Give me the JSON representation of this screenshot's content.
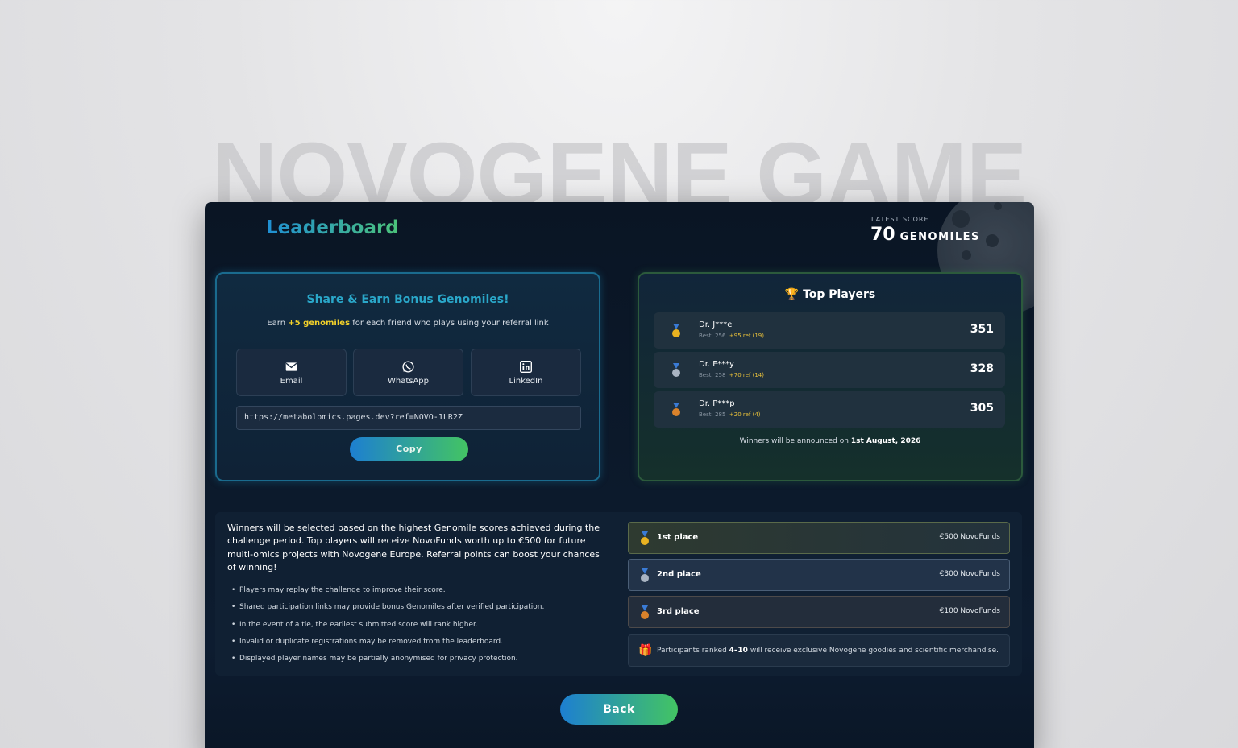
{
  "background_title": "NOVOGENE GAME",
  "header": {
    "title": "Leaderboard",
    "score_label": "LATEST SCORE",
    "score_value": "70",
    "score_unit": "GENOMILES"
  },
  "share": {
    "title": "Share & Earn Bonus Genomiles!",
    "subtitle_prefix": "Earn ",
    "subtitle_highlight": "+5 genomiles",
    "subtitle_suffix": " for each friend who plays using your referral link",
    "buttons": [
      {
        "label": "Email",
        "icon": "envelope-icon"
      },
      {
        "label": "WhatsApp",
        "icon": "whatsapp-icon"
      },
      {
        "label": "LinkedIn",
        "icon": "linkedin-icon"
      }
    ],
    "referral_url": "https://metabolomics.pages.dev?ref=NOVO-1LR2Z",
    "copy_label": "Copy"
  },
  "top_players": {
    "title": "Top Players",
    "title_icon": "trophy-icon",
    "players": [
      {
        "name": "Dr. J***e",
        "best": "Best: 256",
        "ref": "+95 ref (19)",
        "points": "351",
        "medal": "gold"
      },
      {
        "name": "Dr. F***y",
        "best": "Best: 258",
        "ref": "+70 ref (14)",
        "points": "328",
        "medal": "silver"
      },
      {
        "name": "Dr. P***p",
        "best": "Best: 285",
        "ref": "+20 ref (4)",
        "points": "305",
        "medal": "bronze"
      }
    ],
    "announce_prefix": "Winners will be announced on ",
    "announce_date": "1st August, 2026"
  },
  "info": {
    "description": "Winners will be selected based on the highest Genomile scores achieved during the challenge period. Top players will receive NovoFunds worth up to €500 for future multi-omics projects with Novogene Europe. Referral points can boost your chances of winning!",
    "rules": [
      "Players may replay the challenge to improve their score.",
      "Shared participation links may provide bonus Genomiles after verified participation.",
      "In the event of a tie, the earliest submitted score will rank higher.",
      "Invalid or duplicate registrations may be removed from the leaderboard.",
      "Displayed player names may be partially anonymised for privacy protection."
    ],
    "prizes": [
      {
        "place": "1st place",
        "value": "€500 NovoFunds",
        "medal": "gold"
      },
      {
        "place": "2nd place",
        "value": "€300 NovoFunds",
        "medal": "silver"
      },
      {
        "place": "3rd place",
        "value": "€100 NovoFunds",
        "medal": "bronze"
      }
    ],
    "goodies_prefix": "Participants ranked ",
    "goodies_rank": "4–10",
    "goodies_suffix": " will receive exclusive Novogene goodies and scientific merchandise.",
    "goodies_icon": "gift-icon"
  },
  "back_label": "Back",
  "colors": {
    "accent_blue": "#1d7fd1",
    "accent_green": "#43c463",
    "gold": "#e9b321",
    "silver": "#a9b4c2",
    "bronze": "#d9822b"
  }
}
